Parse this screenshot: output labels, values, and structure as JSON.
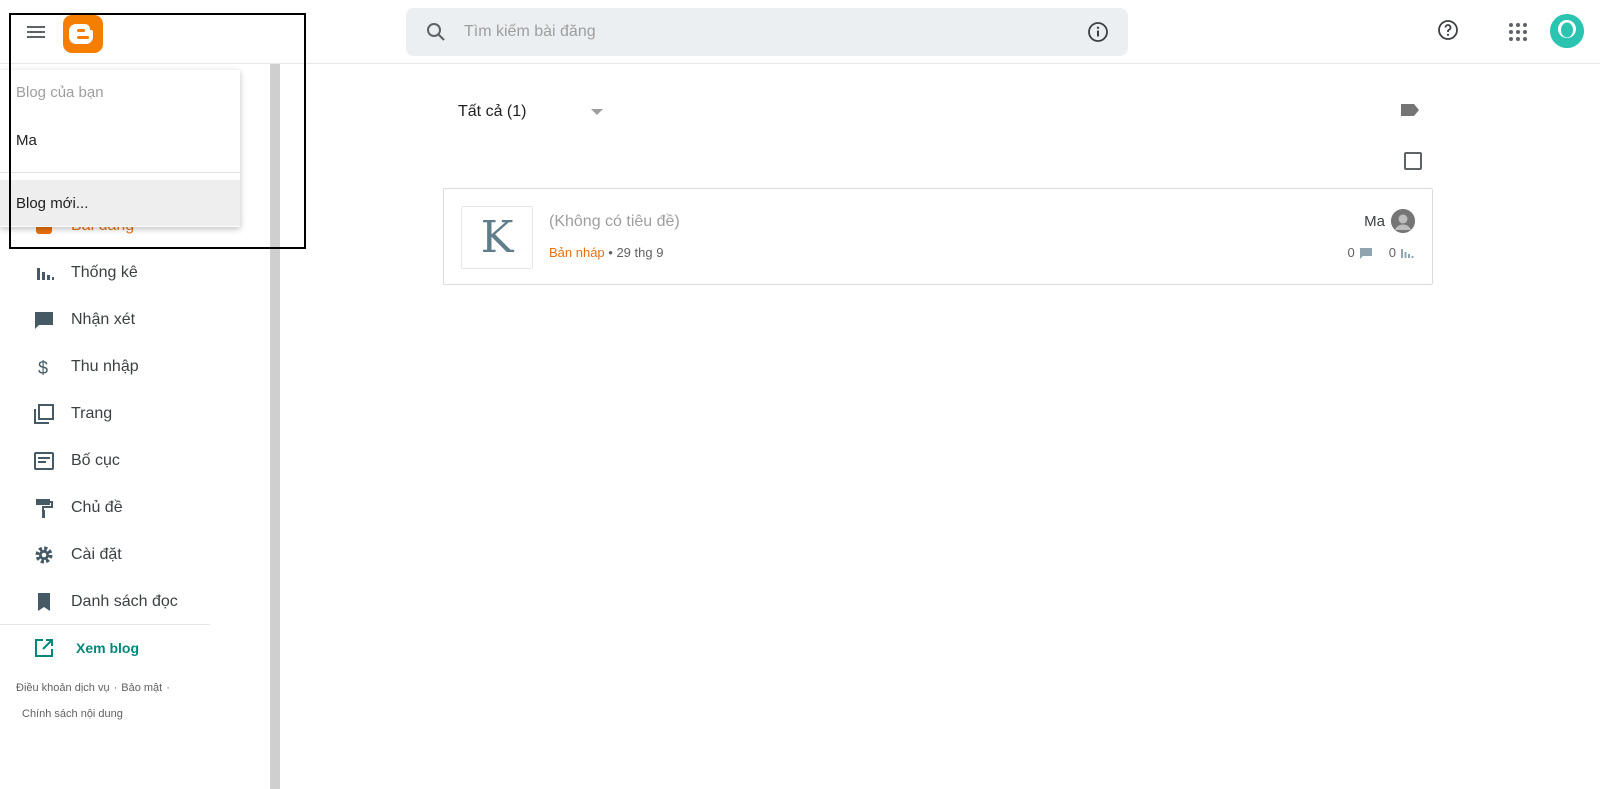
{
  "header": {
    "search_placeholder": "Tìm kiếm bài đăng"
  },
  "dropdown": {
    "header": "Blog của bạn",
    "blog_name": "Ma",
    "new_blog": "Blog mới..."
  },
  "sidebar": {
    "items": [
      {
        "label": "Bài đăng",
        "icon": "posts-icon"
      },
      {
        "label": "Thống kê",
        "icon": "stats-icon"
      },
      {
        "label": "Nhận xét",
        "icon": "comment-icon"
      },
      {
        "label": "Thu nhập",
        "icon": "dollar-icon"
      },
      {
        "label": "Trang",
        "icon": "pages-icon"
      },
      {
        "label": "Bố cục",
        "icon": "layout-icon"
      },
      {
        "label": "Chủ đề",
        "icon": "paint-roller-icon"
      },
      {
        "label": "Cài đặt",
        "icon": "gear-icon"
      },
      {
        "label": "Danh sách đọc",
        "icon": "bookmark-icon"
      }
    ],
    "view_blog": "Xem blog",
    "footer": {
      "terms": "Điều khoản dịch vụ",
      "privacy": "Bảo mật",
      "content_policy": "Chính sách nội dung",
      "sep": "·"
    }
  },
  "main": {
    "filter_label": "Tất cả (1)",
    "post": {
      "thumb_letter": "K",
      "title": "(Không có tiêu đề)",
      "status": "Bản nháp",
      "meta_sep": " • ",
      "date": "29 thg 9",
      "author": "Ma",
      "comments": "0",
      "views": "0"
    }
  },
  "colors": {
    "accent_orange": "#e8710a",
    "logo_orange": "#f57d00",
    "teal": "#00897b",
    "avatar_teal": "#2bc4b0"
  }
}
